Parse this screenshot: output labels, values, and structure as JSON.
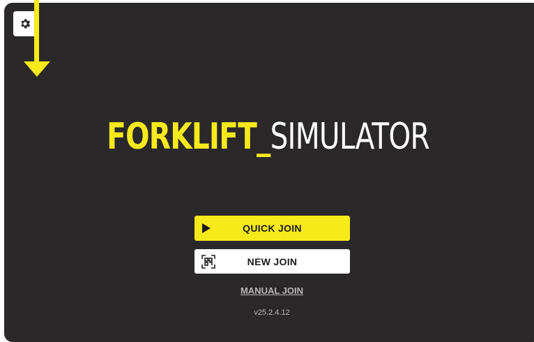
{
  "app": {
    "title_brand": "FORKLIFT_",
    "title_rest": "SIMULATOR",
    "version": "v25.2.4.12"
  },
  "buttons": {
    "quick_join": "QUICK JOIN",
    "new_join": "NEW JOIN",
    "manual_join": "MANUAL JOIN"
  },
  "icons": {
    "settings": "gear-icon",
    "quick_join": "play-icon",
    "new_join": "qr-scan-icon",
    "annotation": "arrow-down-icon"
  },
  "colors": {
    "background": "#2b282a",
    "accent": "#f7ea1a",
    "button_white": "#ffffff",
    "button_text": "#1d1b1c",
    "muted_text": "#b9b6b8"
  }
}
